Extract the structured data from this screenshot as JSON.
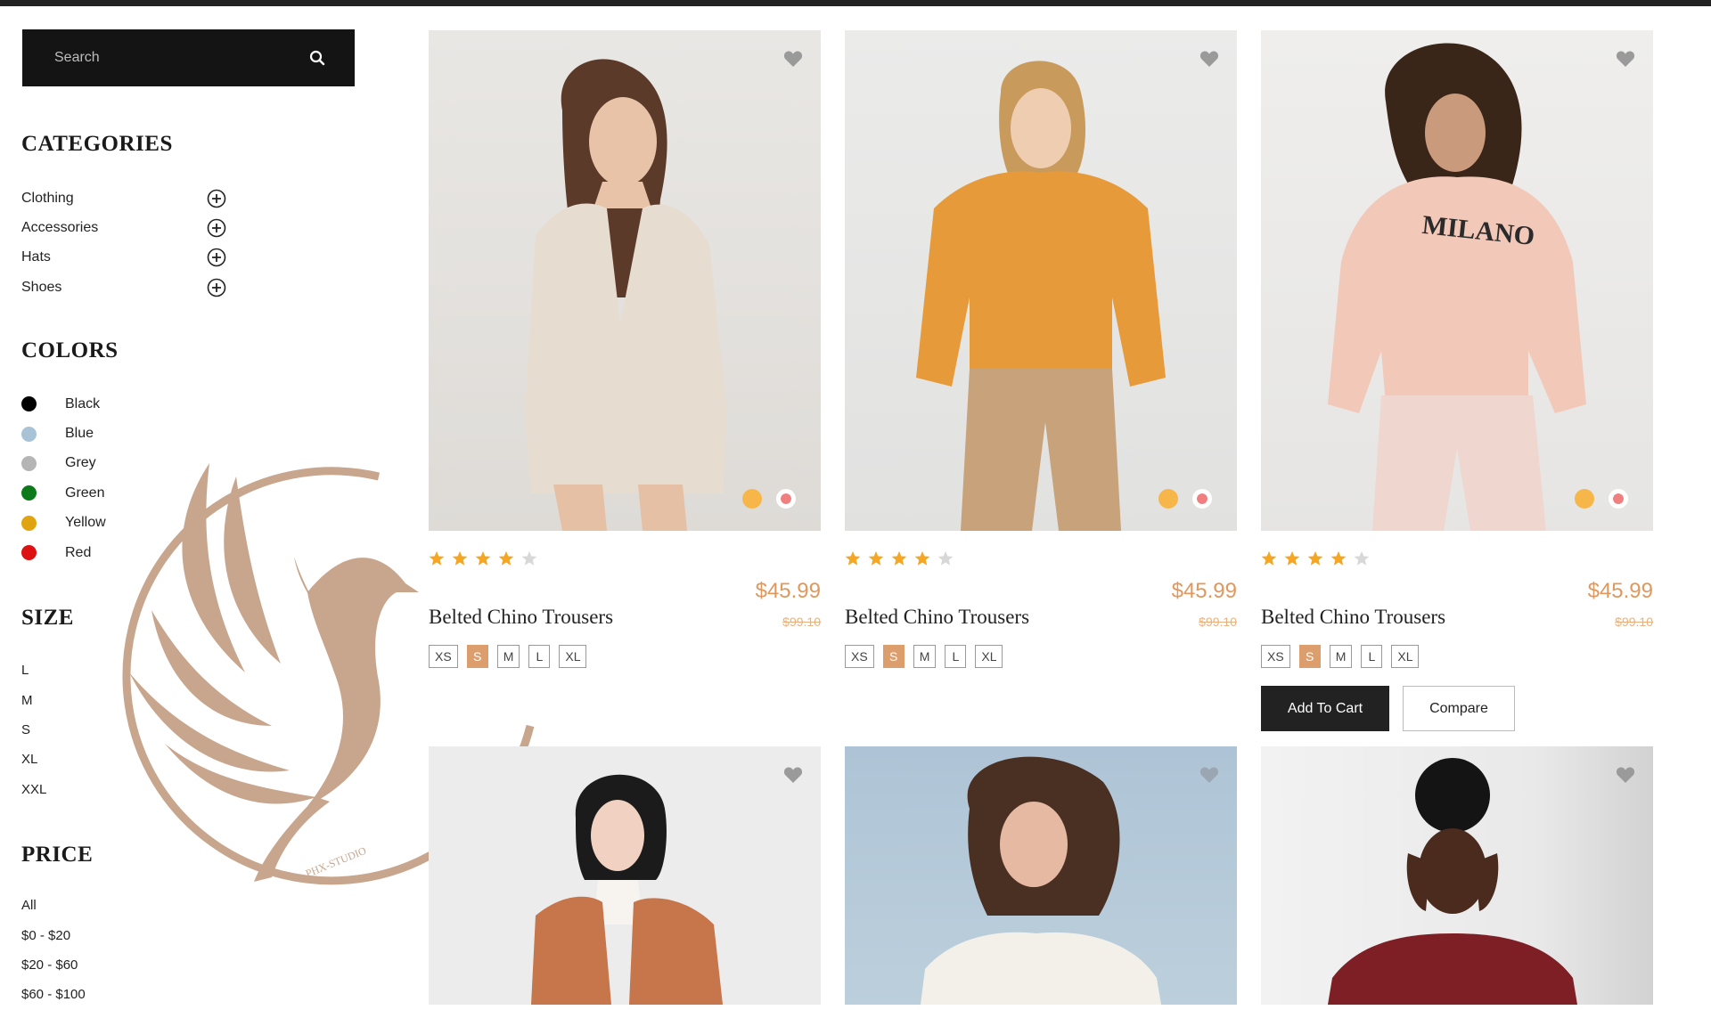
{
  "search": {
    "placeholder": "Search"
  },
  "sidebar": {
    "categories_title": "CATEGORIES",
    "categories": [
      {
        "label": "Clothing"
      },
      {
        "label": "Accessories"
      },
      {
        "label": "Hats"
      },
      {
        "label": "Shoes"
      }
    ],
    "colors_title": "COLORS",
    "colors": [
      {
        "label": "Black",
        "hex": "#000000"
      },
      {
        "label": "Blue",
        "hex": "#a8c3d6"
      },
      {
        "label": "Grey",
        "hex": "#b5b5b5"
      },
      {
        "label": "Green",
        "hex": "#0c7a1a"
      },
      {
        "label": "Yellow",
        "hex": "#e0a412"
      },
      {
        "label": "Red",
        "hex": "#dd1111"
      }
    ],
    "size_title": "SIZE",
    "sizes": [
      "L",
      "M",
      "S",
      "XL",
      "XXL"
    ],
    "price_title": "PRICE",
    "prices": [
      "All",
      "$0 - $20",
      "$20 - $60",
      "$60 - $100"
    ]
  },
  "watermark": {
    "text": "PHX-STUDIO"
  },
  "products": [
    {
      "name": "Belted Chino Trousers",
      "price": "$45.99",
      "old_price": "$99.10",
      "rating": 4,
      "sizes": [
        "XS",
        "S",
        "M",
        "L",
        "XL"
      ],
      "selected_size": "S",
      "swatches": [
        "#f6b64a",
        "#f07f7f"
      ]
    },
    {
      "name": "Belted Chino Trousers",
      "price": "$45.99",
      "old_price": "$99.10",
      "rating": 4,
      "sizes": [
        "XS",
        "S",
        "M",
        "L",
        "XL"
      ],
      "selected_size": "S",
      "swatches": [
        "#f6b64a",
        "#f07f7f"
      ]
    },
    {
      "name": "Belted Chino Trousers",
      "price": "$45.99",
      "old_price": "$99.10",
      "rating": 4,
      "sizes": [
        "XS",
        "S",
        "M",
        "L",
        "XL"
      ],
      "selected_size": "S",
      "swatches": [
        "#f6b64a",
        "#f07f7f"
      ],
      "add_to_cart": "Add To Cart",
      "compare": "Compare"
    }
  ],
  "accent": "#e0985c"
}
